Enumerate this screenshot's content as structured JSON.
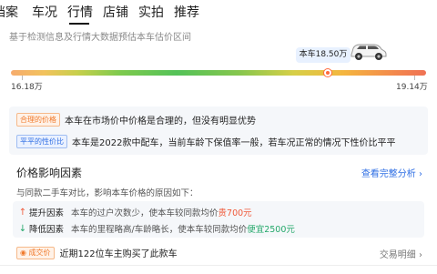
{
  "tabs": [
    {
      "label": "档案"
    },
    {
      "label": "车况"
    },
    {
      "label": "行情"
    },
    {
      "label": "店铺"
    },
    {
      "label": "实拍"
    },
    {
      "label": "推荐"
    }
  ],
  "active_tab": "行情",
  "basis_text": "基于检测信息及行情大数据预估本车估价区间",
  "gauge": {
    "current_label": "本车18.50万",
    "min_label": "16.18万",
    "max_label": "19.14万",
    "position_fraction": 0.76,
    "marker_color": "#ff6a3d"
  },
  "summary": {
    "items": [
      {
        "tag": "合理的价格",
        "text": "本车在市场价中价格是合理的，但没有明显优势"
      },
      {
        "tag": "平平的性价比",
        "text": "本车是2022款中配车，当前车龄下保值率一般，若车况正常的情况下性价比平平"
      }
    ]
  },
  "factors": {
    "title": "价格影响因素",
    "link": "查看完整分析",
    "link_chevron": "›",
    "compare_text": "与同款二手车对比，影响本车价格的原因如下：",
    "rows": [
      {
        "arrow": "up-arrow-icon",
        "label": "提升因素",
        "desc": "本车的过户次数少，使本车较同款均价",
        "amount": "贵700元"
      },
      {
        "arrow": "down-arrow-icon",
        "label": "降低因素",
        "desc": "本车的里程略高/车龄略长，使本车较同款均价",
        "amount": "便宜2500元"
      }
    ]
  },
  "deal": {
    "tag": "成交价",
    "text": "近期122位车主购买了此款车",
    "link": "交易明细",
    "link_chevron": "›"
  },
  "colors": {
    "accent_blue": "#2f6fe4",
    "price_up": "#f05a3a",
    "price_down": "#24a86a",
    "tag_orange": "#f07a2c"
  }
}
